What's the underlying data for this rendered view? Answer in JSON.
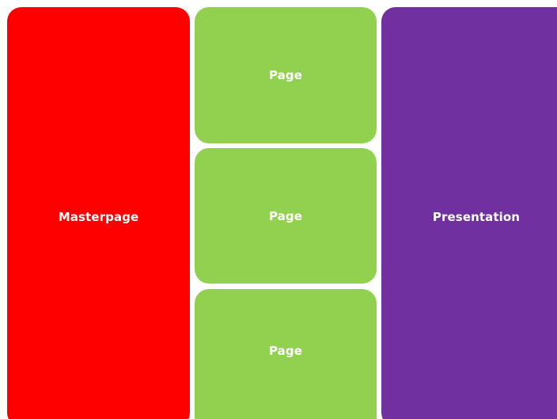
{
  "diagram": {
    "masterpage": {
      "label": "Masterpage",
      "color": "#ff0000"
    },
    "pages": [
      {
        "label": "Page",
        "color": "#92d050"
      },
      {
        "label": "Page",
        "color": "#92d050"
      },
      {
        "label": "Page",
        "color": "#92d050"
      }
    ],
    "presentation": {
      "label": "Presentation",
      "color": "#7030a0"
    }
  }
}
